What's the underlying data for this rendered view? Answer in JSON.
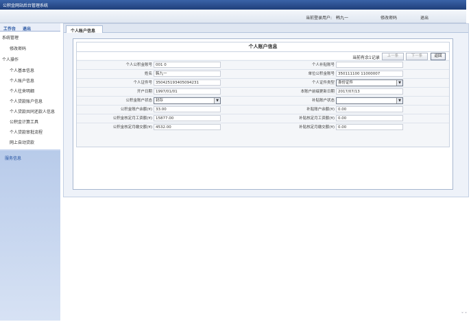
{
  "app": {
    "title": "公积金网站后台管理系统"
  },
  "topbar": {
    "current_user_label": "当前登录用户:",
    "current_user": "韩九一",
    "change_password": "修改密码",
    "logout": "退出"
  },
  "sidebar": {
    "head_left": "工作台",
    "head_right": "退出",
    "items": [
      "系统管理",
      "修改密码",
      "个人操作",
      "个人基本信息",
      "个人账户信息",
      "个人往来明细",
      "个人贷款账户信息",
      "个人贷款共同还款人信息",
      "公积金计算工具",
      "个人贷款审批流程",
      "网上自动贷款"
    ],
    "footer": "服务信息"
  },
  "tab": {
    "label": "个人账户信息"
  },
  "form": {
    "title": "个人账户信息",
    "count_text": "当前有余1记录",
    "prev_btn": "上一条",
    "next_btn": "下一条",
    "back_btn": "返回",
    "rows": [
      {
        "l1": "个人公积金账号",
        "v1": "001    0",
        "l2": "个人补贴账号",
        "v2": ""
      },
      {
        "l1": "姓名",
        "v1": "韩九一",
        "l2": "单位公积金账号",
        "v2": "350111100      11000007"
      },
      {
        "l1": "个人证件号",
        "v1": "350425193405094231",
        "l2": "个人证件类型",
        "v2": "身份证件"
      },
      {
        "l1": "开户日期",
        "v1": "1997/01/01",
        "l2": "本账户前缀更新日期",
        "v2": "2017/07/13"
      },
      {
        "l1": "公积金账户状态",
        "v1": "封存",
        "l2": "补贴账户状态",
        "v2": ""
      },
      {
        "l1": "公积金账户余额(¥)",
        "v1": "33.00",
        "l2": "补贴账户余额(¥)",
        "v2": "0.00"
      },
      {
        "l1": "公积金核定月工资额(¥)",
        "v1": "15877.00",
        "l2": "补贴核定月工资额(¥)",
        "v2": "0.00"
      },
      {
        "l1": "公积金核定月缴交额(¥)",
        "v1": "4532.00",
        "l2": "补贴核定月缴交额(¥)",
        "v2": "0.00"
      }
    ]
  },
  "colors": {
    "titlebar": "#1f3f7a",
    "sidebar": "#c8d6ef",
    "link": "#1f4f9f"
  }
}
